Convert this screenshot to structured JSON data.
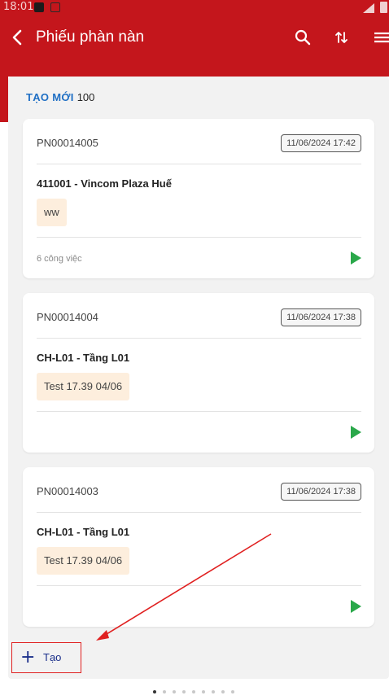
{
  "status_bar": {
    "time": "18:01"
  },
  "app_bar": {
    "title": "Phiếu phàn nàn",
    "back_icon": "chevron-left-icon",
    "actions": [
      "search-icon",
      "sort-icon",
      "filter-icon"
    ]
  },
  "group": {
    "label": "TẠO MỚI",
    "count": "100"
  },
  "cards": [
    {
      "code": "PN00014005",
      "date": "11/06/2024  17:42",
      "store": "411001 - Vincom Plaza Huế",
      "note": "ww",
      "tasks": "6 công việc"
    },
    {
      "code": "PN00014004",
      "date": "11/06/2024  17:38",
      "store": "CH-L01 - Tầng L01",
      "note": "Test 17.39 04/06",
      "tasks": ""
    },
    {
      "code": "PN00014003",
      "date": "11/06/2024  17:38",
      "store": "CH-L01 - Tầng L01",
      "note": "Test 17.39 04/06",
      "tasks": ""
    }
  ],
  "create_button": {
    "label": "Tạo",
    "icon": "plus-icon"
  },
  "pagination": {
    "total": 9,
    "active": 1
  },
  "colors": {
    "primary": "#c4161c",
    "group_label": "#1f6fc4",
    "play": "#2aa84a",
    "note_bg": "#fdeedd",
    "annotation": "#e02020"
  }
}
